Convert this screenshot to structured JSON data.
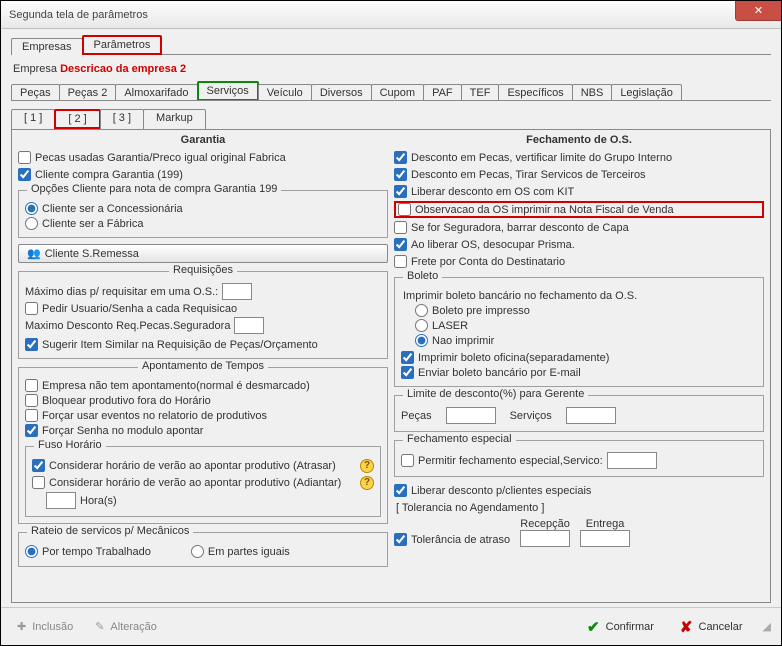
{
  "window": {
    "title": "Segunda tela de parâmetros"
  },
  "mainTabs": {
    "t0": "Empresas",
    "t1": "Parâmetros"
  },
  "empresa": {
    "label": "Empresa",
    "desc": "Descricao da empresa 2"
  },
  "subTabs": {
    "t0": "Peças",
    "t1": "Peças 2",
    "t2": "Almoxarifado",
    "t3": "Serviços",
    "t4": "Veículo",
    "t5": "Diversos",
    "t6": "Cupom",
    "t7": "PAF",
    "t8": "TEF",
    "t9": "Específicos",
    "t10": "NBS",
    "t11": "Legislação"
  },
  "numTabs": {
    "n1": "[ 1 ]",
    "n2": "[ 2 ]",
    "n3": "[ 3 ]",
    "n4": "Markup"
  },
  "left": {
    "header": "Garantia",
    "c1": "Pecas usadas Garantia/Preco igual original Fabrica",
    "c2": "Cliente compra Garantia (199)",
    "grpOpcoes": "Opções Cliente para nota de compra Garantia 199",
    "r1": "Cliente ser a Concessionária",
    "r2": "Cliente ser a Fábrica",
    "btnRemessa": "Cliente S.Remessa",
    "grpReq": "Requisições",
    "maxDias": "Máximo dias p/ requisitar em uma O.S.:",
    "c3": "Pedir Usuario/Senha a cada Requisicao",
    "maxDesc": "Maximo Desconto Req.Pecas.Seguradora",
    "c4": "Sugerir Item Similar na Requisição de Peças/Orçamento",
    "grpApont": "Apontamento de Tempos",
    "c5": "Empresa não tem apontamento(normal é desmarcado)",
    "c6": "Bloquear produtivo fora do Horário",
    "c7": "Forçar usar eventos no relatorio de produtivos",
    "c8": "Forçar Senha no modulo apontar",
    "grpFuso": "Fuso Horário",
    "c9": "Considerar horário de verão ao apontar produtivo (Atrasar)",
    "c10": "Considerar horário de verão ao apontar produtivo (Adiantar)",
    "horas": "Hora(s)",
    "grpRateio": "Rateio de servicos p/ Mecânicos",
    "r3": "Por tempo Trabalhado",
    "r4": "Em partes iguais"
  },
  "right": {
    "header": "Fechamento de O.S.",
    "c1": "Desconto em Pecas, vertificar limite do Grupo Interno",
    "c2": "Desconto em Pecas, Tirar Servicos de Terceiros",
    "c3": "Liberar desconto em OS com KIT",
    "c4": "Observacao da OS imprimir na Nota Fiscal de Venda",
    "c5": "Se for Seguradora, barrar desconto de Capa",
    "c6": "Ao liberar OS, desocupar Prisma.",
    "c7": "Frete por Conta do Destinatario",
    "grpBoleto": "Boleto",
    "boletoLine": "Imprimir boleto bancário no fechamento da O.S.",
    "rb1": "Boleto pre impresso",
    "rb2": "LASER",
    "rb3": "Nao imprimir",
    "c8": "Imprimir boleto oficina(separadamente)",
    "c9": "Enviar boleto bancário por E-mail",
    "grpLimite": "Limite de desconto(%) para Gerente",
    "pecas": "Peças",
    "servicos": "Serviços",
    "grpFech": "Fechamento especial",
    "c10": "Permitir fechamento especial,Servico:",
    "c11": "Liberar desconto p/clientes especiais",
    "tolLabel": "[ Tolerancia no Agendamento ]",
    "recepcao": "Recepção",
    "entrega": "Entrega",
    "c12": "Tolerância de atraso"
  },
  "footer": {
    "inclusao": "Inclusão",
    "alteracao": "Alteração",
    "confirmar": "Confirmar",
    "cancelar": "Cancelar"
  }
}
